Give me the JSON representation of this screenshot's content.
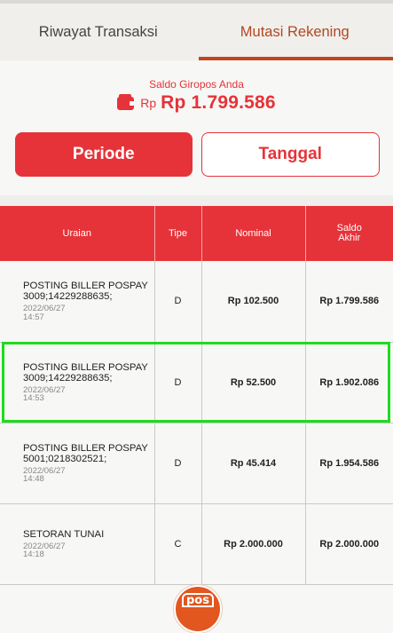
{
  "tabs": [
    {
      "label": "Riwayat Transaksi",
      "active": false
    },
    {
      "label": "Mutasi Rekening",
      "active": true
    }
  ],
  "saldo": {
    "label": "Saldo Giropos Anda",
    "currency": "Rp",
    "amount": "Rp 1.799.586",
    "icon": "wallet-icon"
  },
  "buttons": {
    "periode": "Periode",
    "tanggal": "Tanggal"
  },
  "table": {
    "headers": {
      "uraian": "Uraian",
      "tipe": "Tipe",
      "nominal": "Nominal",
      "saldo_line1": "Saldo",
      "saldo_line2": "Akhir"
    },
    "rows": [
      {
        "desc_line1": "POSTING BILLER POSPAY",
        "desc_line2": "3009;14229288635;",
        "date": "2022/06/27",
        "time": "14:57",
        "tipe": "D",
        "nominal": "Rp 102.500",
        "saldo": "Rp 1.799.586"
      },
      {
        "desc_line1": "POSTING BILLER POSPAY",
        "desc_line2": "3009;14229288635;",
        "date": "2022/06/27",
        "time": "14:53",
        "tipe": "D",
        "nominal": "Rp 52.500",
        "saldo": "Rp 1.902.086"
      },
      {
        "desc_line1": "POSTING BILLER POSPAY",
        "desc_line2": "5001;0218302521;",
        "date": "2022/06/27",
        "time": "14:48",
        "tipe": "D",
        "nominal": "Rp 45.414",
        "saldo": "Rp 1.954.586"
      },
      {
        "desc_line1": "SETORAN TUNAI",
        "desc_line2": "",
        "date": "2022/06/27",
        "time": "14:18",
        "tipe": "C",
        "nominal": "Rp 2.000.000",
        "saldo": "Rp 2.000.000"
      }
    ]
  },
  "logo": {
    "text": "pos"
  },
  "colors": {
    "brand_red": "#e53339",
    "active_tab": "#c1461e",
    "highlight": "#1edb1e"
  }
}
